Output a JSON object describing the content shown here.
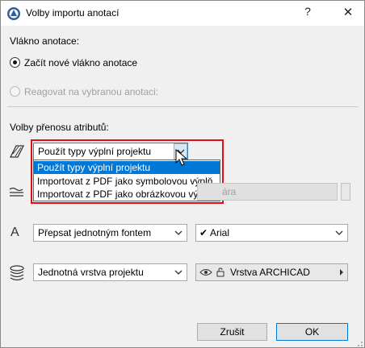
{
  "window": {
    "title": "Volby importu anotací",
    "help_label": "?",
    "close_label": "✕"
  },
  "thread": {
    "section_label": "Vlákno anotace:",
    "option_new": "Začít nové vlákno anotace",
    "option_reply": "Reagovat na vybranou anotaci:",
    "selected": "option_new"
  },
  "transfer": {
    "section_label": "Volby přenosu atributů:"
  },
  "fill_row": {
    "icon": "fill-type-icon",
    "combo_value": "Použít typy výplní projektu",
    "options": [
      "Použít typy výplní projektu",
      "Importovat z PDF jako symbolovou výplň",
      "Importovat z PDF jako obrázkovou výplň"
    ],
    "selected_index": 0
  },
  "line_row": {
    "icon": "line-type-icon",
    "combo_value": "",
    "right_value_tail": "ára"
  },
  "font_row": {
    "icon": "font-icon",
    "icon_glyph": "A",
    "combo_value": "Přepsat jednotným fontem",
    "font_value": "Arial",
    "font_check": "✔"
  },
  "layer_row": {
    "icon": "layer-icon",
    "combo_value": "Jednotná vrstva projektu",
    "layer_value": "Vrstva ARCHICAD"
  },
  "buttons": {
    "cancel": "Zrušit",
    "ok": "OK"
  },
  "colors": {
    "highlight": "#e01010",
    "selection": "#0078d7"
  }
}
